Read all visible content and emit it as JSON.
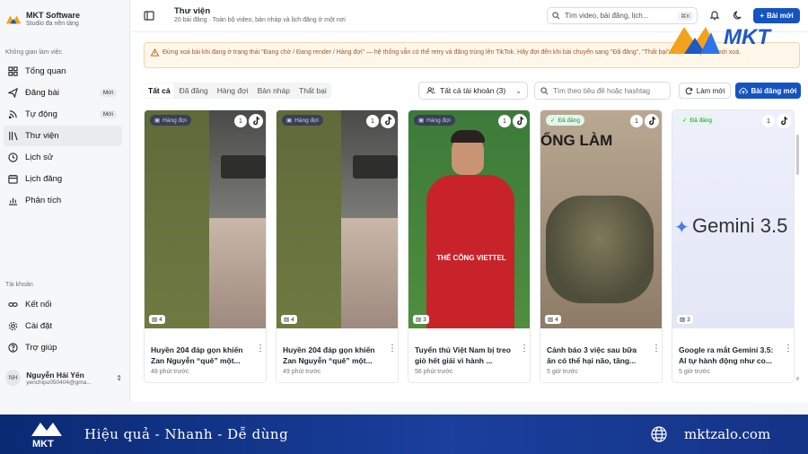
{
  "brand": {
    "name": "MKT Software",
    "subtitle": "Studio đa nền tảng"
  },
  "sidebar": {
    "workspace_label": "Không gian làm việc",
    "items": [
      {
        "label": "Tổng quan",
        "icon": "grid-icon"
      },
      {
        "label": "Đăng bài",
        "icon": "send-icon",
        "badge": "Mới"
      },
      {
        "label": "Tự động",
        "icon": "rss-icon",
        "badge": "Mới"
      },
      {
        "label": "Thư viện",
        "icon": "library-icon"
      },
      {
        "label": "Lịch sử",
        "icon": "clock-icon"
      },
      {
        "label": "Lịch đăng",
        "icon": "calendar-icon"
      },
      {
        "label": "Phân tích",
        "icon": "chart-icon"
      }
    ],
    "account_label": "Tài khoản",
    "account_items": [
      {
        "label": "Kết nối",
        "icon": "link-icon"
      },
      {
        "label": "Cài đặt",
        "icon": "gear-icon"
      },
      {
        "label": "Trợ giúp",
        "icon": "help-icon"
      }
    ],
    "user": {
      "initials": "NH",
      "name": "Nguyễn Hải Yến",
      "email": "yenchipu050404@gma..."
    }
  },
  "header": {
    "title": "Thư viện",
    "subtitle": "20 bài đăng · Toàn bộ video, bản nháp và lịch đăng ở một nơi",
    "search_placeholder": "Tìm video, bài đăng, lịch...",
    "shortcut": "⌘K",
    "new_post_label": "Bài mới"
  },
  "warning": "Đừng xoá bài khi đang ở trạng thái \"Đang chờ / Đang render / Hàng đợi\" — hệ thống vẫn có thể retry và đăng trùng lên TikTok. Hãy đợi đến khi bài chuyển sang \"Đã đăng\", \"Thất bại\" hoặc \"Nháp\" rồi mới xoá.",
  "tabs": [
    "Tất cả",
    "Đã đăng",
    "Hàng đợi",
    "Bản nháp",
    "Thất bại"
  ],
  "account_filter": "Tất cả tài khoản (3)",
  "filter_placeholder": "Tìm theo tiêu đề hoặc hashtag",
  "refresh_label": "Làm mới",
  "new_post_label2": "Bài đăng mới",
  "cards": [
    {
      "status": "Hàng đợi",
      "status_type": "pending",
      "count": "1",
      "media": "4",
      "title": "Huyền 204 đáp gọn khiến Zan Nguyễn “quê” một...",
      "time": "48 phút trước"
    },
    {
      "status": "Hàng đợi",
      "status_type": "pending",
      "count": "1",
      "media": "4",
      "title": "Huyền 204 đáp gọn khiến Zan Nguyễn “quê” một...",
      "time": "49 phút trước"
    },
    {
      "status": "Hàng đợi",
      "status_type": "pending",
      "count": "1",
      "media": "3",
      "title": "Tuyển thủ Việt Nam bị treo giò hết giải vì hành ...",
      "time": "56 phút trước"
    },
    {
      "status": "Đã đăng",
      "status_type": "done",
      "count": "1",
      "media": "4",
      "title": "Cảnh báo 3 việc sau bữa ăn có thể hại não, tăng...",
      "time": "5 giờ trước"
    },
    {
      "status": "Đã đăng",
      "status_type": "done",
      "count": "1",
      "media": "3",
      "title": "Google ra mắt Gemini 3.5: AI tự hành động như co...",
      "time": "5 giờ trước"
    }
  ],
  "thumb_text": {
    "card3_jersey": "THẾ CÔNG VIETTEL",
    "card4_caption": "ỐNG LÀM",
    "card5_caption": "Gemini 3.5"
  },
  "watermark": "MKT",
  "footer": {
    "slogan": "Hiệu quả - Nhanh - Dễ dùng",
    "site": "mktzalo.com"
  },
  "colors": {
    "primary": "#1554c0",
    "warning_bg": "#fff7ea",
    "warning_text": "#a4572b",
    "footer": "#1a3f9c"
  }
}
